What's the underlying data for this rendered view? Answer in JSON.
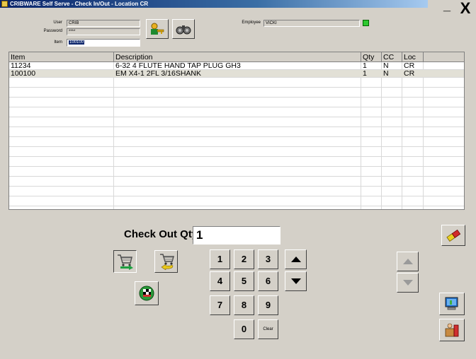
{
  "window": {
    "title": "CRIBWARE Self Serve - Check In/Out - Location CR",
    "min_glyph": "_",
    "close_glyph": "X"
  },
  "form": {
    "user_label": "User",
    "user_value": "CRIB",
    "password_label": "Password",
    "password_value": "****",
    "item_label": "Item",
    "item_value": "100100",
    "employee_label": "Employee",
    "employee_value": "VICKI"
  },
  "grid": {
    "columns": [
      "Item",
      "Description",
      "Qty",
      "CC",
      "Loc"
    ],
    "rows": [
      [
        "11234",
        "6-32 4 FLUTE HAND TAP PLUG GH3",
        "1",
        "N",
        "CR"
      ],
      [
        "100100",
        "EM X4-1 2FL 3/16SHANK",
        "1",
        "N",
        "CR"
      ]
    ]
  },
  "checkout": {
    "label": "Check Out Qty:",
    "value": "1"
  },
  "keypad": {
    "k1": "1",
    "k2": "2",
    "k3": "3",
    "k4": "4",
    "k5": "5",
    "k6": "6",
    "k7": "7",
    "k8": "8",
    "k9": "9",
    "k0": "0",
    "clear": "Clear"
  },
  "icons": {
    "login": "key-person-icon",
    "binoculars": "binoculars-icon",
    "cart_out": "cart-checkout-icon",
    "cart_in": "cart-return-icon",
    "finish": "checkered-flag-icon",
    "pill": "eraser-icon",
    "computer": "computer-icon",
    "exit": "box-exit-icon"
  },
  "colors": {
    "title_bar": "#0a246a",
    "face": "#d4d0c8",
    "indicator": "#2ec830"
  }
}
